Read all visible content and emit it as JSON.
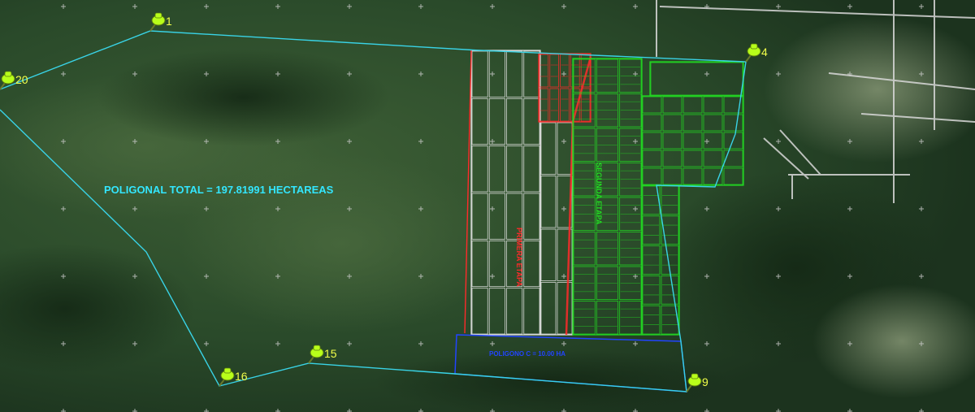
{
  "map": {
    "total_label": "POLIGONAL TOTAL = 197.81991 HECTAREAS",
    "polygon_c_label": "POLIGONO C = 10.00 HA",
    "red_zone_label": "PRIMERA ETAPA",
    "green_zone_label": "SEGUNDA ETAPA",
    "markers": [
      {
        "label": "1"
      },
      {
        "label": "4"
      },
      {
        "label": "9"
      },
      {
        "label": "15"
      },
      {
        "label": "16"
      },
      {
        "label": "20"
      }
    ],
    "colors": {
      "boundary": "#39d3e6",
      "red_lots": "#ff2a2a",
      "green_lots": "#22dd22",
      "white_lots": "#e6e6e6",
      "polygon_c": "#2244ff",
      "marker": "#b8ff1a",
      "marker_label": "#f2ff4a",
      "total_label": "#33e6ff"
    },
    "marker_icon": "pushpin-icon",
    "grid_icon": "crosshair-icon"
  }
}
